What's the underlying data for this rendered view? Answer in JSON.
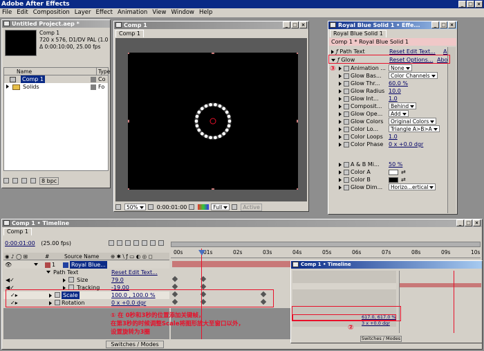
{
  "app": {
    "title": "Adobe After Effects"
  },
  "menu": [
    "File",
    "Edit",
    "Composition",
    "Layer",
    "Effect",
    "Animation",
    "View",
    "Window",
    "Help"
  ],
  "project": {
    "title": "Untitled Project.aep *",
    "comp_name": "Comp 1",
    "comp_info1": "720 x 576, D1/DV PAL (1.0",
    "comp_info2": "Δ 0:00:10:00, 25.00 fps",
    "col_name": "Name",
    "col_type": "Type",
    "items": [
      {
        "name": "Comp 1",
        "type": "Co"
      },
      {
        "name": "Solids",
        "type": "Fo"
      }
    ],
    "bpc": "8 bpc"
  },
  "comp": {
    "title": "Comp 1",
    "tab": "Comp 1",
    "zoom": "50%",
    "time": "0:00:01:00",
    "resolution": "Full",
    "view": "Active"
  },
  "effects": {
    "title": "Royal Blue Solid 1 • Effe...",
    "tab": "Royal Blue Solid 1",
    "breadcrumb": "Comp 1 * Royal Blue Solid 1",
    "path_text": {
      "label": "Path Text",
      "reset": "Reset Edit Text...",
      "about": "Abo"
    },
    "glow": {
      "label": "Glow",
      "reset": "Reset Options...",
      "about": "About"
    },
    "rows": [
      {
        "label": "Animation ...",
        "value": "None"
      },
      {
        "label": "Glow Bas...",
        "value": "Color Channels"
      },
      {
        "label": "Glow Thr...",
        "value": "60.0 %"
      },
      {
        "label": "Glow Radius",
        "value": "10.0"
      },
      {
        "label": "Glow Int...",
        "value": "1.0"
      },
      {
        "label": "Composit...",
        "value": "Behind"
      },
      {
        "label": "Glow Ope...",
        "value": "Add"
      },
      {
        "label": "Glow Colors",
        "value": "Original Colors"
      },
      {
        "label": "Color Lo...",
        "value": "Triangle A>B>A"
      },
      {
        "label": "Color Loops",
        "value": "1.0"
      },
      {
        "label": "Color Phase",
        "value": "0 x +0.0 dgr"
      },
      {
        "label": "A & B Mi...",
        "value": "50 %"
      },
      {
        "label": "Color A",
        "value": ""
      },
      {
        "label": "Color B",
        "value": ""
      },
      {
        "label": "Glow Dim...",
        "value": "Horizo...ertical"
      }
    ]
  },
  "timeline": {
    "title": "Comp 1 • Timeline",
    "tab": "Comp 1",
    "time": "0:00:01:00",
    "fps": "(25.00 fps)",
    "col_num": "#",
    "col_source": "Source Name",
    "ticks": [
      "00s",
      "01s",
      "02s",
      "03s",
      "04s",
      "05s",
      "06s",
      "07s",
      "08s",
      "09s",
      "10s"
    ],
    "layer": {
      "num": "1",
      "name": "Royal Blue..."
    },
    "path_text": {
      "label": "Path Text",
      "value": "Reset Edit Text..."
    },
    "size": {
      "label": "Size",
      "value": "79.0"
    },
    "tracking": {
      "label": "Tracking",
      "value": "-19.00"
    },
    "scale": {
      "label": "Scale",
      "value": "100.0 , 100.0 %"
    },
    "rotation": {
      "label": "Rotation",
      "value": "0 x +0.0 dgr"
    },
    "switches": "Switches / Modes"
  },
  "inset": {
    "title": "Comp 1 • Timeline",
    "scale": "617.0, 617.0 %",
    "rotation": "3 x +0.0 dgr",
    "switches": "Switches / Modes"
  },
  "annotations": {
    "n1": "① 在 0秒和3秒的位置添加关键帧，",
    "n1b": "在第3秒的时候调整Scale将图形放大至窗口以外，",
    "n1c": "设置旋转为3圈",
    "n2": "②",
    "n3": "③"
  },
  "colors": {
    "highlight": "#e8102a",
    "titlebar": "#0a2a86",
    "timeline_bar": "#c87878"
  }
}
